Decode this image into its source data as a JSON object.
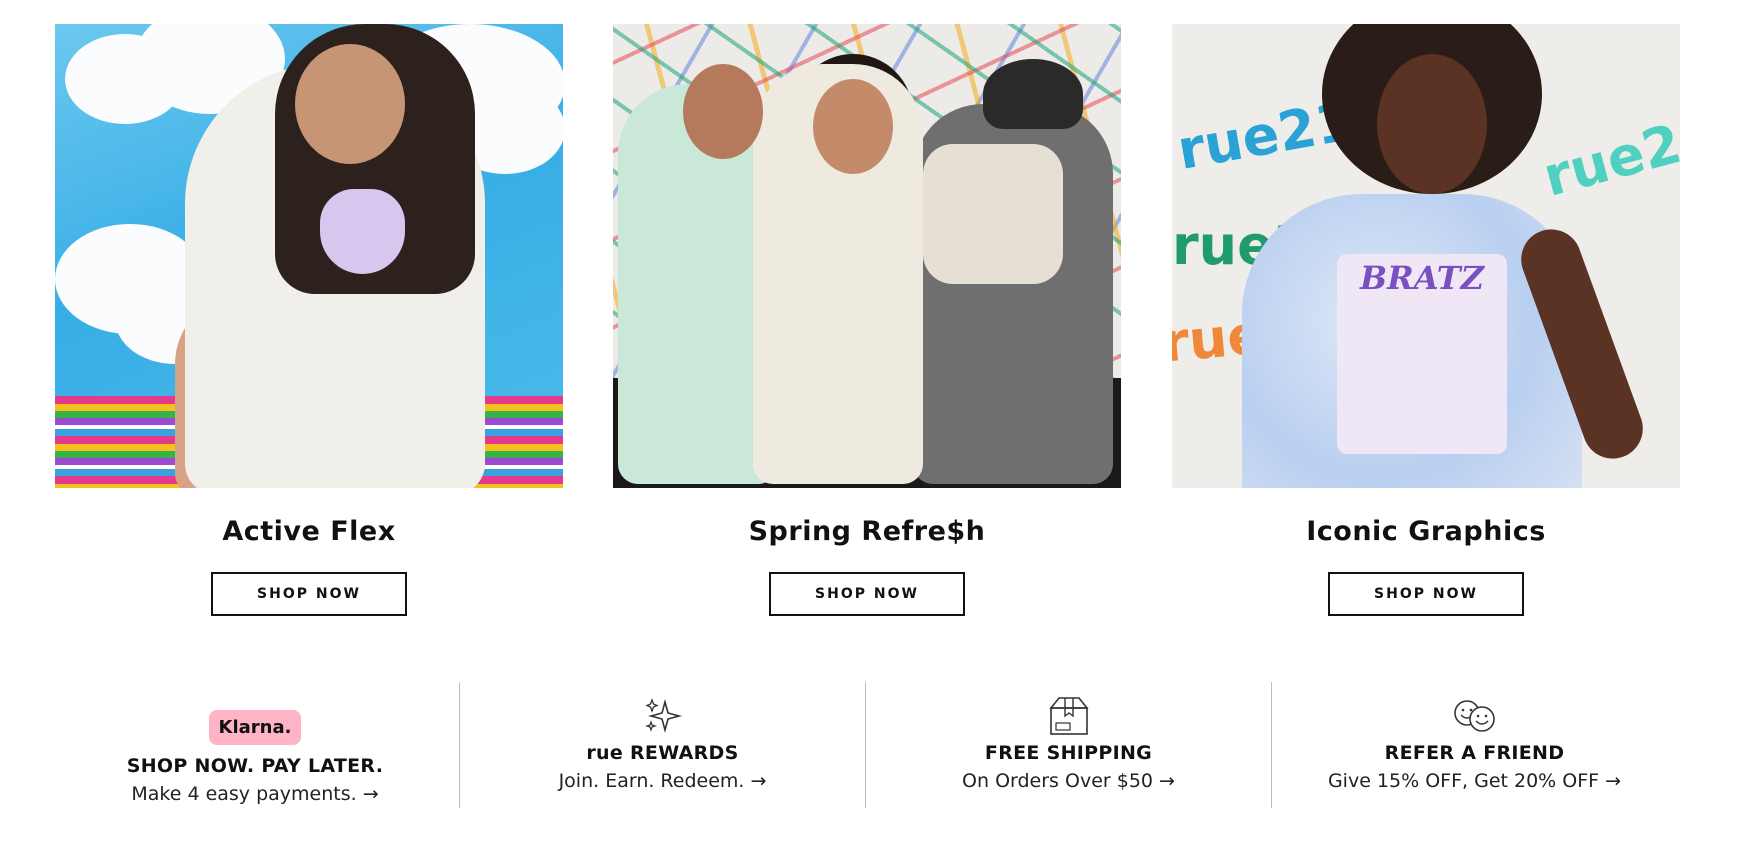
{
  "promos": [
    {
      "title": "Active Flex",
      "button": "SHOP NOW"
    },
    {
      "title": "Spring Refre$h",
      "button": "SHOP NOW"
    },
    {
      "title": "Iconic Graphics",
      "button": "SHOP NOW"
    }
  ],
  "features": [
    {
      "badge": "Klarna.",
      "heading": "SHOP NOW. PAY LATER.",
      "sub": "Make 4 easy payments. →",
      "icon": "klarna-logo"
    },
    {
      "heading": "rue REWARDS",
      "sub": "Join. Earn. Redeem. →",
      "icon": "sparkles-icon"
    },
    {
      "heading": "FREE SHIPPING",
      "sub": "On Orders Over $50 →",
      "icon": "box-icon"
    },
    {
      "heading": "REFER A FRIEND",
      "sub": "Give 15% OFF, Get 20% OFF →",
      "icon": "smiley-faces-icon"
    }
  ],
  "image_text": {
    "tshirt_brand": "BRATZ",
    "wall_text": [
      "rue21",
      "rue2",
      "RUE21"
    ]
  },
  "colors": {
    "klarna_pink": "#ffb3c7",
    "border": "#111111",
    "divider": "#bdbdbd"
  }
}
